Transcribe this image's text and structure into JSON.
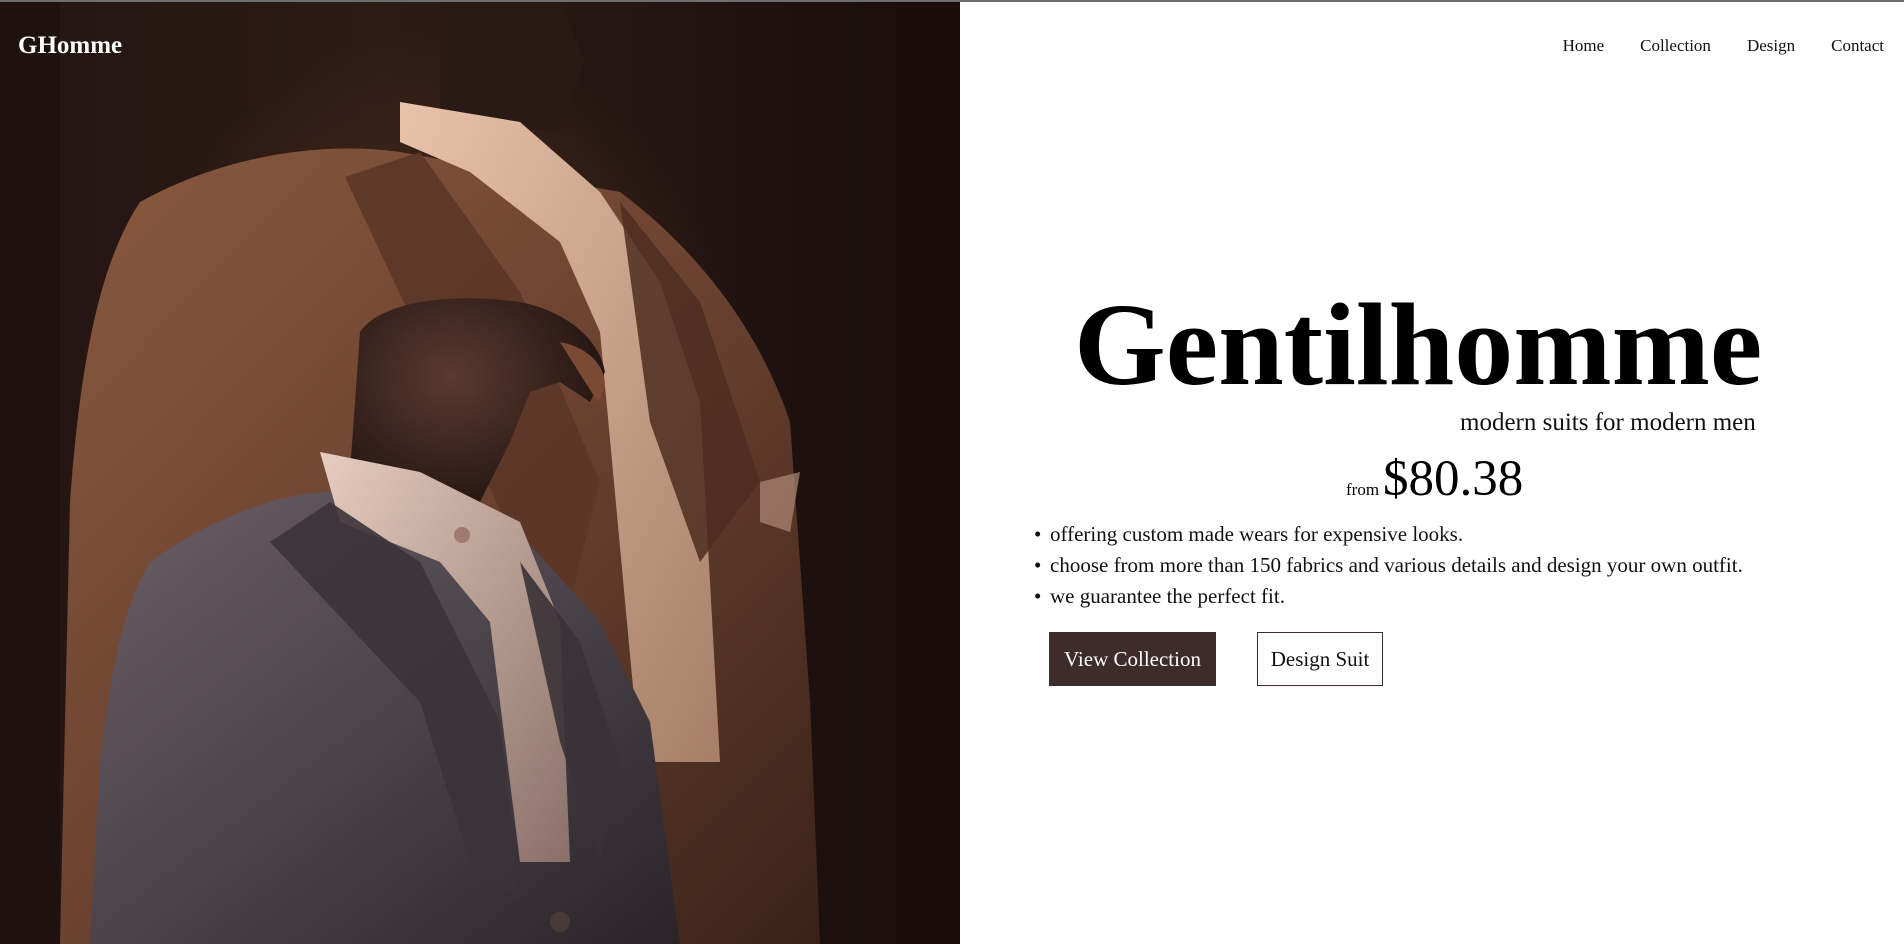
{
  "brand": {
    "name": "GHomme"
  },
  "nav": {
    "items": [
      {
        "label": "Home"
      },
      {
        "label": "Collection"
      },
      {
        "label": "Design"
      },
      {
        "label": "Contact"
      }
    ]
  },
  "hero": {
    "image_description_icon": "suits-on-mannequins-photo",
    "title": "Gentilhomme",
    "tagline": "modern suits for modern men",
    "price": {
      "prefix": "from",
      "value": "$80.38"
    },
    "features": [
      "offering custom made wears for expensive looks.",
      "choose from more than 150 fabrics and various details and design your own outfit.",
      "we guarantee the perfect fit."
    ],
    "buttons": {
      "primary_label": "View Collection",
      "secondary_label": "Design Suit"
    }
  },
  "colors": {
    "accent": "#3e2b2b",
    "photo_dark": "#231513",
    "photo_warm": "#8a5a3f"
  }
}
